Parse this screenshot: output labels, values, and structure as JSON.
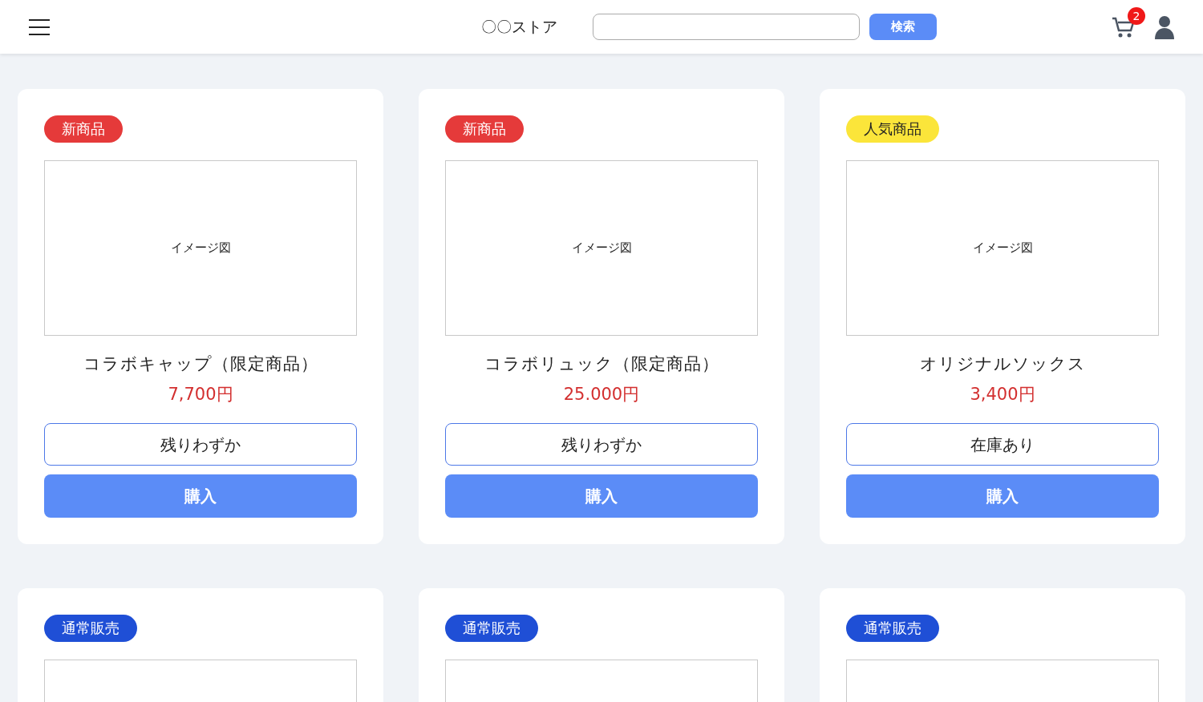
{
  "header": {
    "store_name": "〇〇ストア",
    "search": {
      "button": "検索"
    },
    "cart_count": "2"
  },
  "products": [
    {
      "tag": {
        "label": "新商品",
        "color": "#e53a3a"
      },
      "image_label": "イメージ図",
      "name": "コラボキャップ（限定商品）",
      "price": "7,700円",
      "stock": "残りわずか",
      "buy": "購入"
    },
    {
      "tag": {
        "label": "新商品",
        "color": "#e53a3a"
      },
      "image_label": "イメージ図",
      "name": "コラボリュック（限定商品）",
      "price": "25.000円",
      "stock": "残りわずか",
      "buy": "購入"
    },
    {
      "tag": {
        "label": "人気商品",
        "color": "#fbe53a"
      },
      "image_label": "イメージ図",
      "name": "オリジナルソックス",
      "price": "3,400円",
      "stock": "在庫あり",
      "buy": "購入"
    },
    {
      "tag": {
        "label": "通常販売",
        "color": "#1f4fd6"
      }
    },
    {
      "tag": {
        "label": "通常販売",
        "color": "#1f4fd6"
      }
    },
    {
      "tag": {
        "label": "通常販売",
        "color": "#1f4fd6"
      }
    }
  ]
}
